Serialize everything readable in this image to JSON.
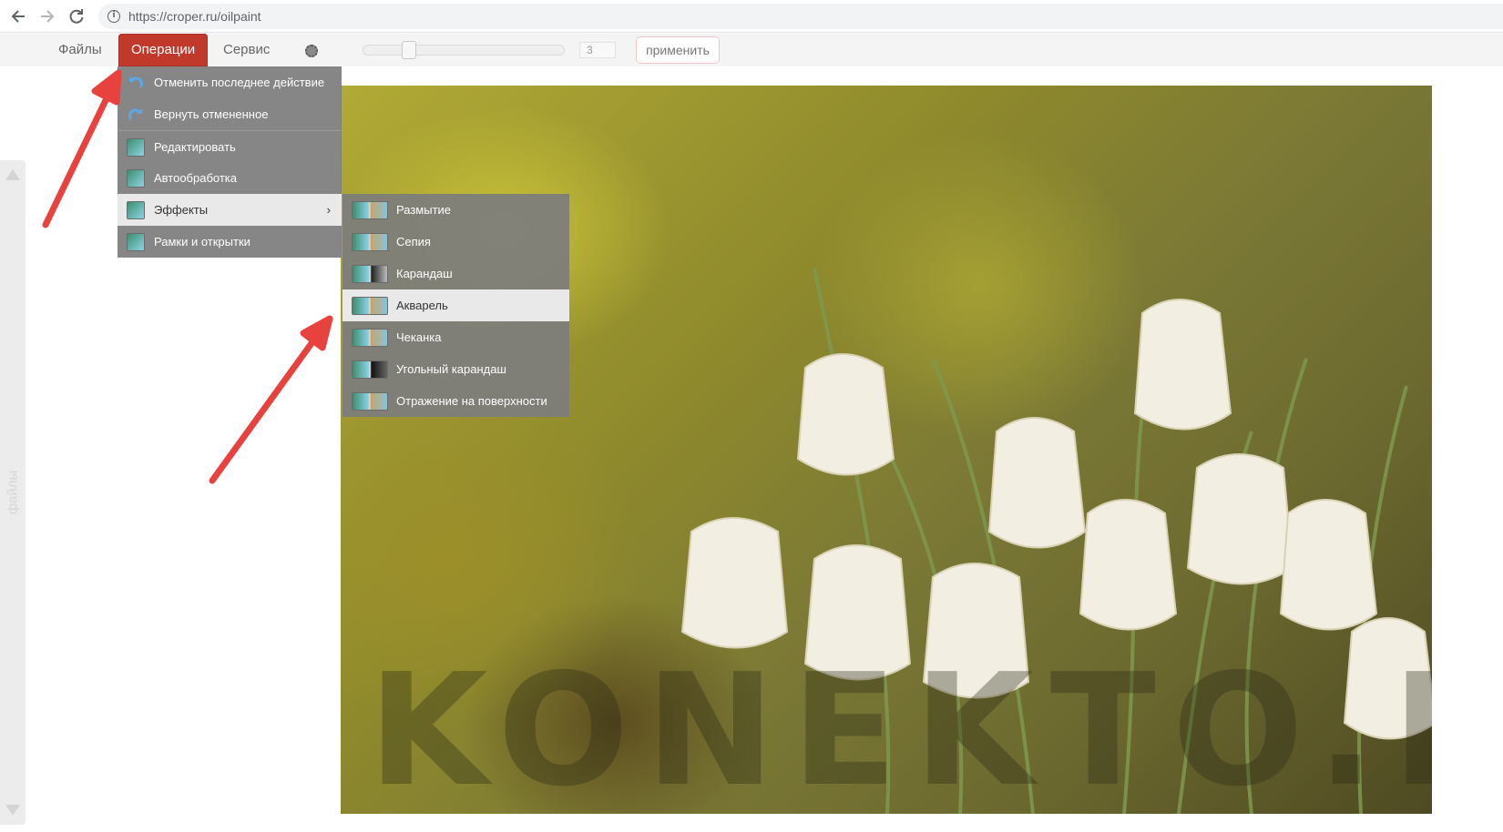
{
  "browser": {
    "url": "https://croper.ru/oilpaint"
  },
  "toolbar": {
    "tabs": [
      {
        "label": "Файлы"
      },
      {
        "label": "Операции"
      },
      {
        "label": "Сервис"
      }
    ],
    "slider_value": "3",
    "apply_label": "применить"
  },
  "side_panel": {
    "label": "файлы"
  },
  "operations_menu": {
    "items": [
      {
        "label": "Отменить последнее действие",
        "icon": "undo-icon"
      },
      {
        "label": "Вернуть отмененное",
        "icon": "redo-icon"
      },
      {
        "label": "Редактировать",
        "icon": "edit-image-icon"
      },
      {
        "label": "Автообработка",
        "icon": "auto-process-icon"
      },
      {
        "label": "Эффекты",
        "icon": "effects-icon",
        "submenu_arrow": "›"
      },
      {
        "label": "Рамки и открытки",
        "icon": "frames-icon"
      }
    ]
  },
  "effects_menu": {
    "items": [
      {
        "label": "Размытие",
        "icon": "blur-icon"
      },
      {
        "label": "Сепия",
        "icon": "sepia-icon"
      },
      {
        "label": "Карандаш",
        "icon": "pencil-icon"
      },
      {
        "label": "Акварель",
        "icon": "watercolor-icon"
      },
      {
        "label": "Чеканка",
        "icon": "emboss-icon"
      },
      {
        "label": "Угольный карандаш",
        "icon": "charcoal-icon"
      },
      {
        "label": "Отражение на поверхности",
        "icon": "reflection-icon"
      }
    ]
  },
  "photo": {
    "watermark": "KONEKTO.RU"
  },
  "colors": {
    "accent_red": "#c0392b",
    "menu_bg": "#7d7d7d",
    "arrow_red": "#e8423f"
  }
}
